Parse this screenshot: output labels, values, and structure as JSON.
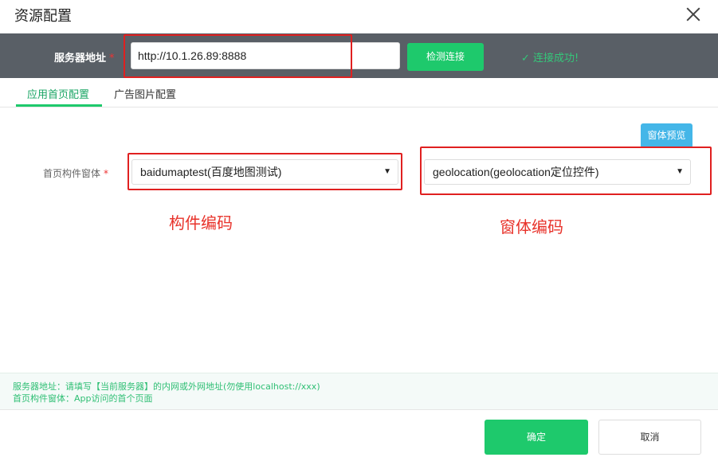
{
  "dialog": {
    "title": "资源配置"
  },
  "server": {
    "label": "服务器地址",
    "required_mark": "*",
    "address_value": "http://10.1.26.89:8888",
    "test_button": "检测连接",
    "status_text": "✓ 连接成功!"
  },
  "tabs": [
    {
      "label": "应用首页配置",
      "active": true
    },
    {
      "label": "广告图片配置",
      "active": false
    }
  ],
  "home": {
    "preview_button": "窗体预览",
    "field_label": "首页构件窗体",
    "required_mark": "*",
    "component_select": "baidumaptest(百度地图测试)",
    "form_select": "geolocation(geolocation定位控件)"
  },
  "annotations": {
    "component_code": "构件编码",
    "form_code": "窗体编码"
  },
  "hints": [
    "服务器地址：请填写【当前服务器】的内网或外网地址(勿使用localhost://xxx)",
    "首页构件窗体：App访问的首个页面"
  ],
  "footer": {
    "ok": "确定",
    "cancel": "取消"
  },
  "colors": {
    "accent": "#1ec96c",
    "header_bar": "#595f66",
    "annotation": "#e02020",
    "preview": "#44b6e8"
  }
}
